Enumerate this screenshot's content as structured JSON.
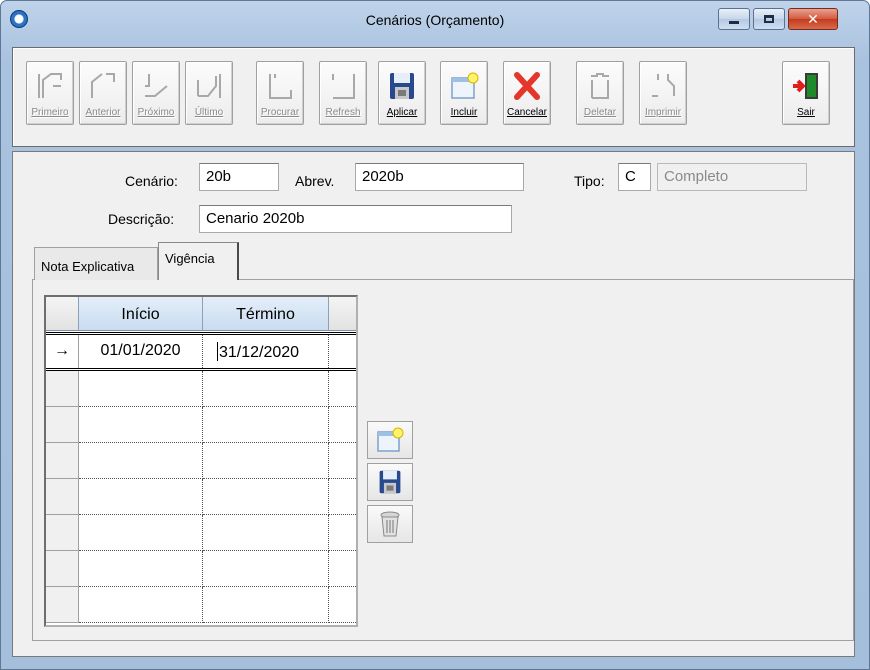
{
  "window": {
    "title": "Cenários (Orçamento)"
  },
  "toolbar": {
    "buttons": [
      {
        "label": "Primeiro",
        "icon": "first-record-icon",
        "enabled": false
      },
      {
        "label": "Anterior",
        "icon": "previous-record-icon",
        "enabled": false
      },
      {
        "label": "Próximo",
        "icon": "next-record-icon",
        "enabled": false
      },
      {
        "label": "Último",
        "icon": "last-record-icon",
        "enabled": false
      },
      {
        "label": "Procurar",
        "icon": "search-icon",
        "enabled": false
      },
      {
        "label": "Refresh",
        "icon": "refresh-icon",
        "enabled": false
      },
      {
        "label": "Aplicar",
        "icon": "save-disk-icon",
        "enabled": true
      },
      {
        "label": "Incluir",
        "icon": "new-record-icon",
        "enabled": true
      },
      {
        "label": "Cancelar",
        "icon": "cancel-x-icon",
        "enabled": true
      },
      {
        "label": "Deletar",
        "icon": "delete-icon",
        "enabled": false
      },
      {
        "label": "Imprimir",
        "icon": "print-icon",
        "enabled": false
      },
      {
        "label": "Sair",
        "icon": "exit-door-icon",
        "enabled": true
      }
    ]
  },
  "form": {
    "cenario_label": "Cenário:",
    "cenario_value": "20b",
    "abrev_label": "Abrev.",
    "abrev_value": "2020b",
    "tipo_label": "Tipo:",
    "tipo_value": "C",
    "tipo_desc": "Completo",
    "descricao_label": "Descrição:",
    "descricao_value": "Cenario 2020b"
  },
  "tabs": [
    {
      "label": "Nota Explicativa",
      "active": false
    },
    {
      "label": "Vigência",
      "active": true
    }
  ],
  "grid": {
    "columns": [
      "Início",
      "Término"
    ],
    "current_row_indicator": "→",
    "rows": [
      {
        "inicio": "01/01/2020",
        "termino": "31/12/2020"
      }
    ],
    "empty_rows": 7
  },
  "side_buttons": [
    {
      "icon": "new-record-icon"
    },
    {
      "icon": "save-disk-icon"
    },
    {
      "icon": "trash-can-icon"
    }
  ]
}
